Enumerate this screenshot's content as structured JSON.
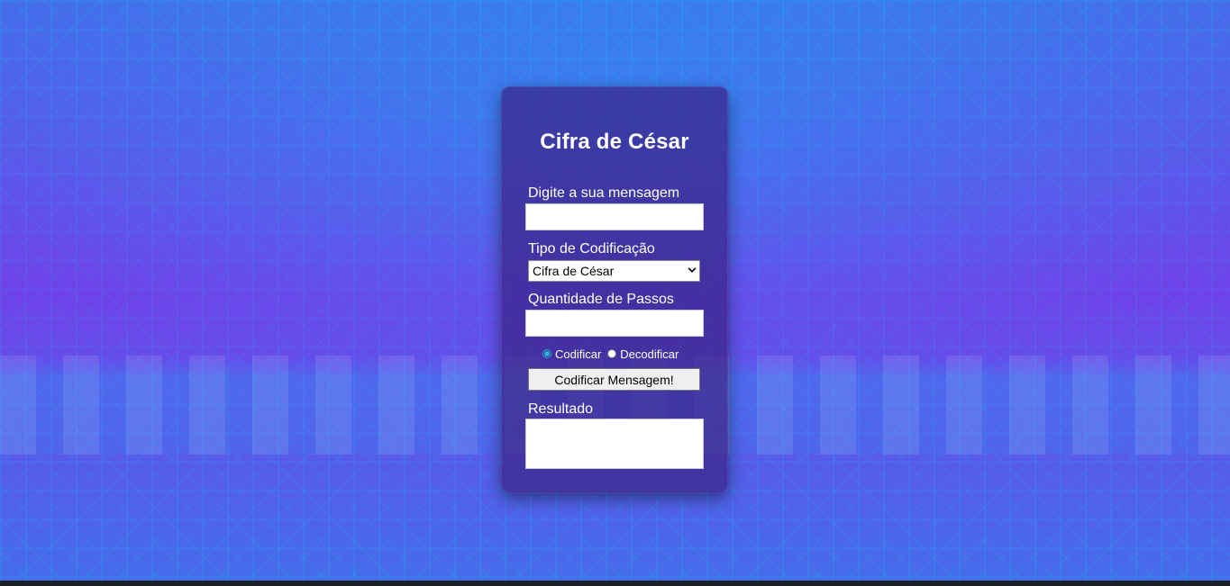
{
  "card": {
    "title": "Cifra de César",
    "fields": {
      "message_label": "Digite a sua mensagem",
      "message_value": "",
      "encoding_type_label": "Tipo de Codificação",
      "encoding_type_selected": "Cifra de César",
      "steps_label": "Quantidade de Passos",
      "steps_value": "",
      "result_label": "Resultado",
      "result_value": ""
    },
    "mode": {
      "options": [
        {
          "label": "Codificar",
          "selected": true
        },
        {
          "label": "Decodificar",
          "selected": false
        }
      ]
    },
    "actions": {
      "encode_button_label": "Codificar Mensagem!"
    }
  },
  "colors": {
    "card_bg": "#3a2387",
    "page_accent_blue": "#00c3ff",
    "page_accent_purple": "#6a3fe0",
    "button_bg": "#efefef"
  },
  "icons": {
    "dropdown": "chevron-down-icon"
  }
}
